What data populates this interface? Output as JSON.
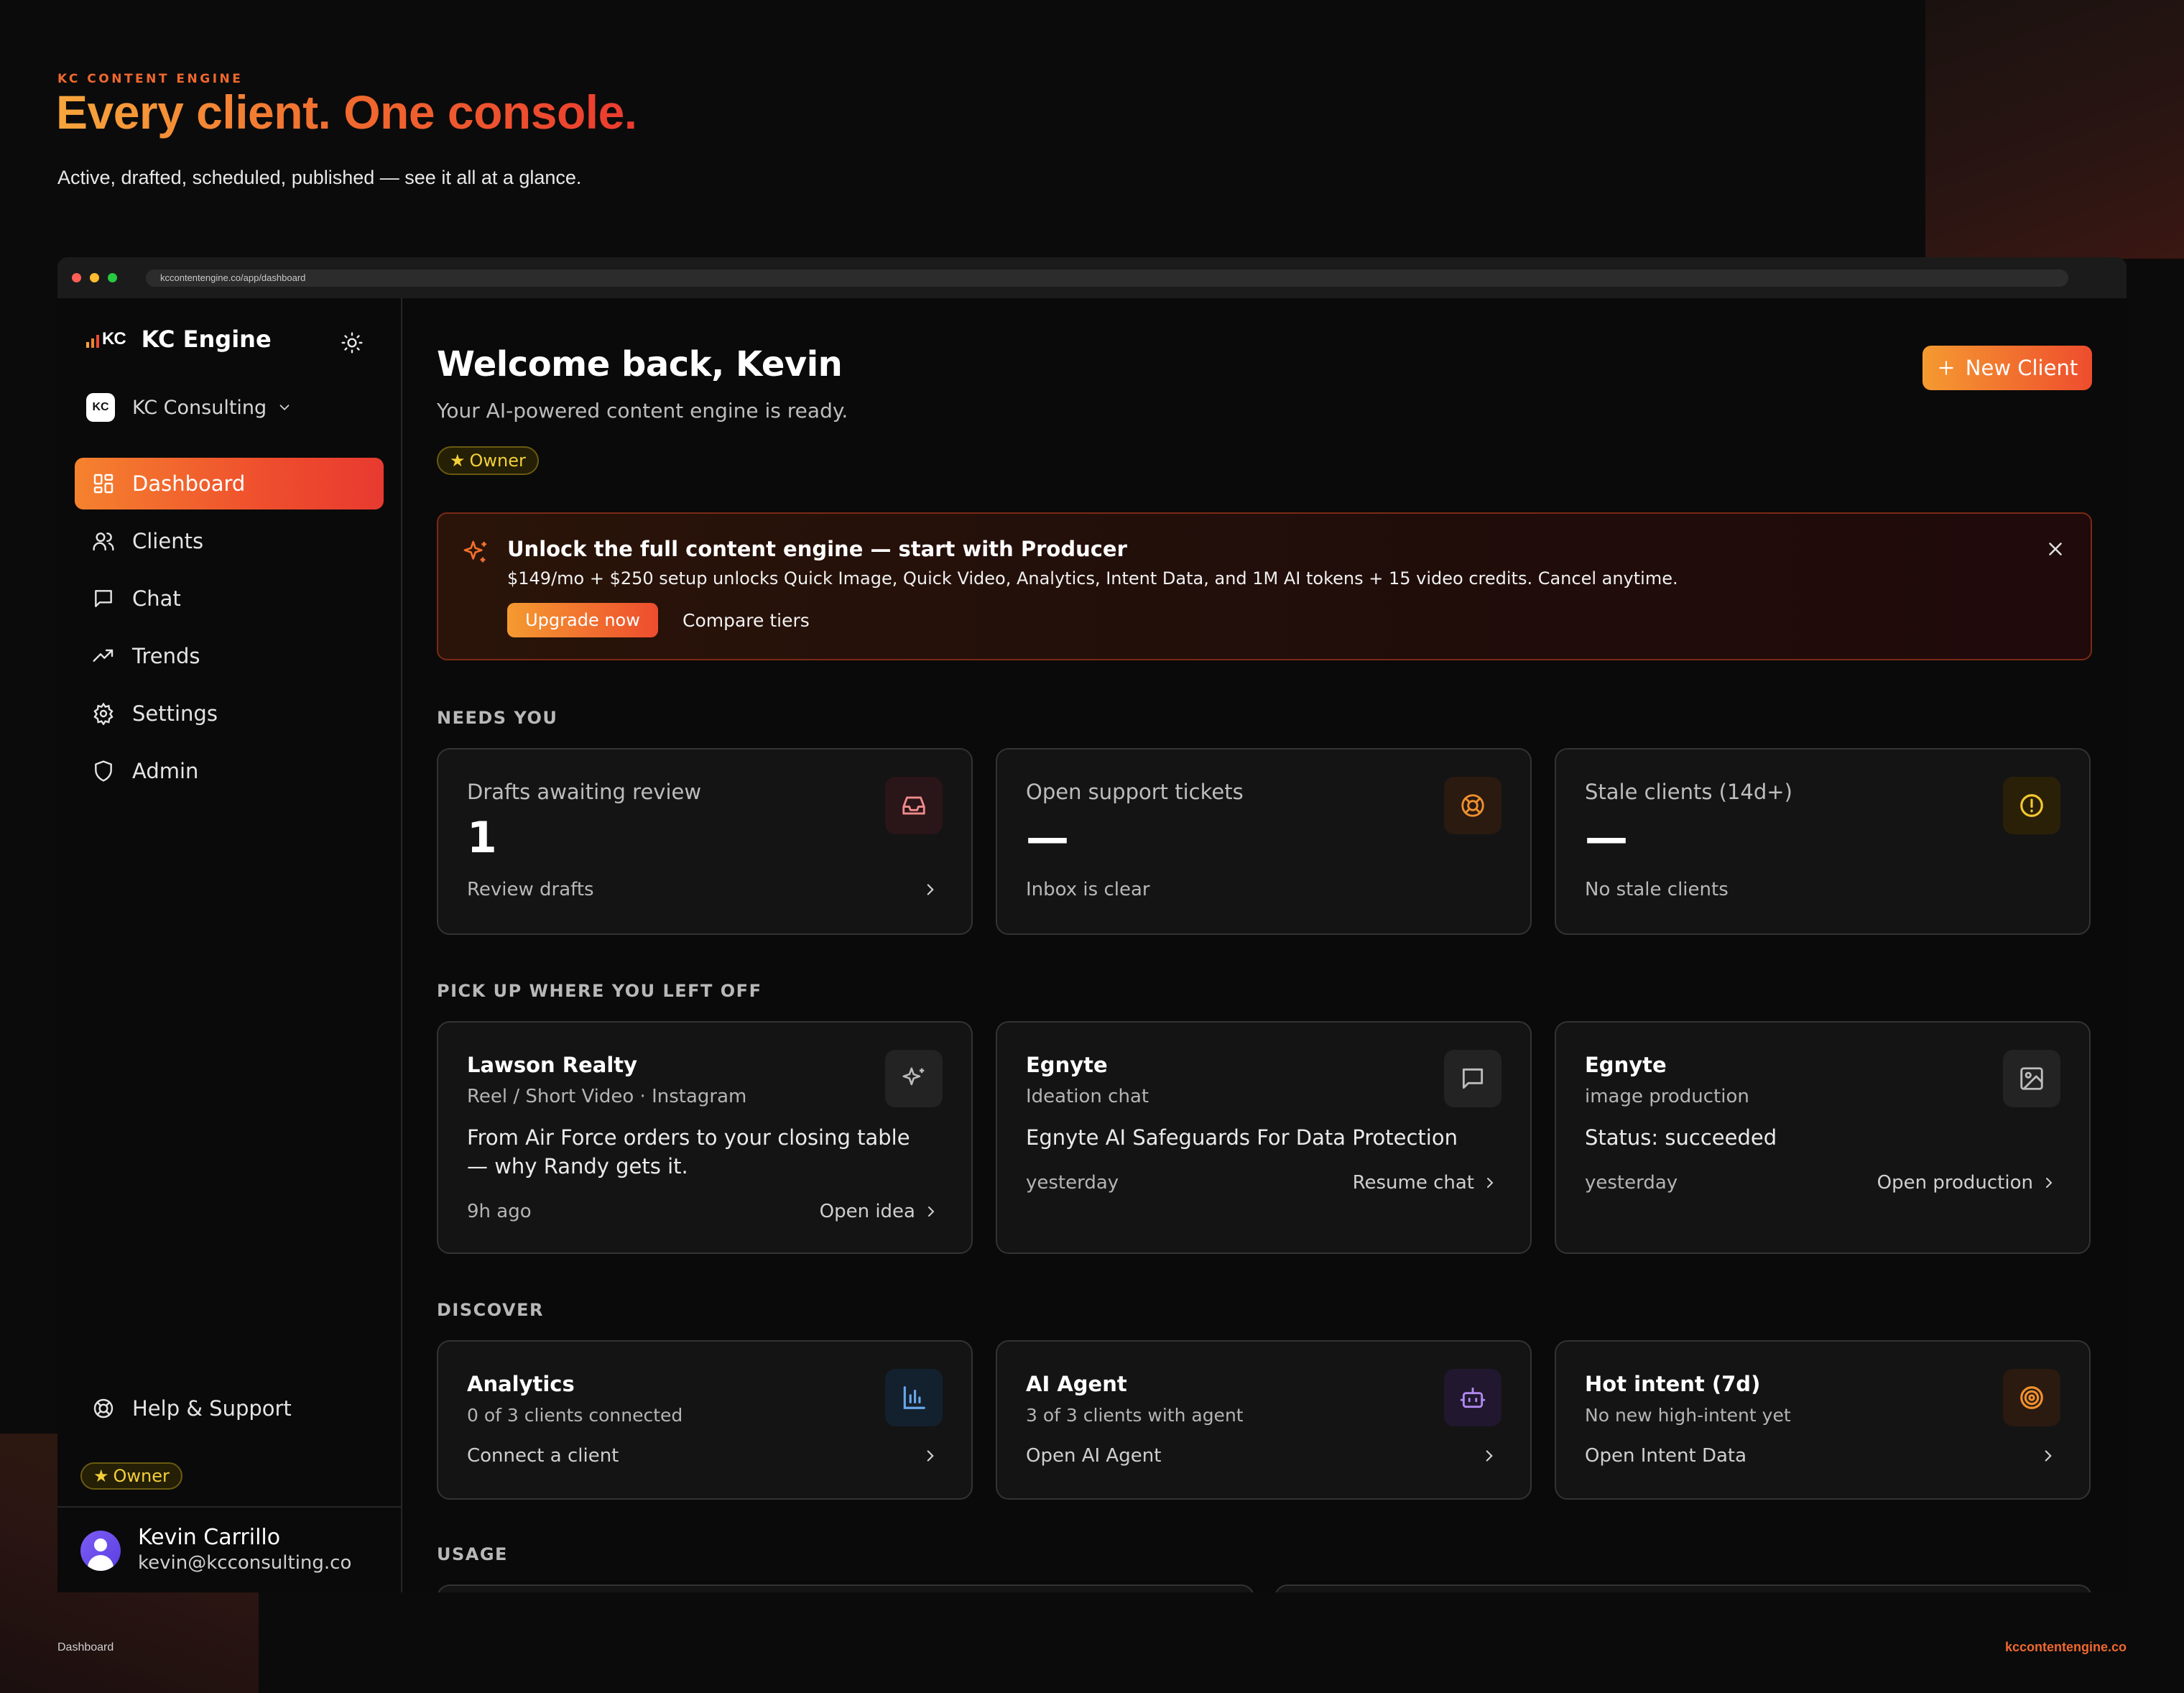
{
  "hero": {
    "kicker": "KC CONTENT ENGINE",
    "title": "Every client. One console.",
    "subtitle": "Active, drafted, scheduled, published — see it all at a glance."
  },
  "browser": {
    "url": "kccontentengine.co/app/dashboard",
    "dots": [
      "#ff5f57",
      "#febc2e",
      "#28c840"
    ]
  },
  "sidebar": {
    "brand_mark": "KC",
    "brand_name": "KC Engine",
    "org_badge": "KC",
    "org_name": "KC Consulting",
    "nav": [
      {
        "label": "Dashboard",
        "icon": "dashboard-icon",
        "active": true
      },
      {
        "label": "Clients",
        "icon": "users-icon"
      },
      {
        "label": "Chat",
        "icon": "chat-icon"
      },
      {
        "label": "Trends",
        "icon": "trend-icon"
      },
      {
        "label": "Settings",
        "icon": "gear-icon"
      },
      {
        "label": "Admin",
        "icon": "shield-icon"
      }
    ],
    "help_label": "Help & Support",
    "owner_badge": "Owner",
    "user_name": "Kevin Carrillo",
    "user_email": "kevin@kcconsulting.co"
  },
  "main": {
    "welcome": "Welcome back, Kevin",
    "subtitle": "Your AI-powered content engine is ready.",
    "owner_badge": "Owner",
    "new_client_label": "New Client",
    "promo": {
      "title": "Unlock the full content engine — start with Producer",
      "text": "$149/mo + $250 setup unlocks Quick Image, Quick Video, Analytics, Intent Data, and 1M AI tokens + 15 video credits. Cancel anytime.",
      "upgrade_label": "Upgrade now",
      "compare_label": "Compare tiers"
    },
    "needs_you": {
      "label": "NEEDS YOU",
      "cards": [
        {
          "title": "Drafts awaiting review",
          "value": "1",
          "foot": "Review drafts",
          "icon": "inbox-icon"
        },
        {
          "title": "Open support tickets",
          "value": "—",
          "foot": "Inbox is clear",
          "icon": "lifebuoy-icon"
        },
        {
          "title": "Stale clients (14d+)",
          "value": "—",
          "foot": "No stale clients",
          "icon": "alert-circle-icon"
        }
      ]
    },
    "pickup": {
      "label": "PICK UP WHERE YOU LEFT OFF",
      "cards": [
        {
          "name": "Lawson Realty",
          "meta": "Reel / Short Video · Instagram",
          "body": "From Air Force orders to your closing table — why Randy gets it.",
          "time": "9h ago",
          "link": "Open idea",
          "icon": "sparkles-icon"
        },
        {
          "name": "Egnyte",
          "meta": "Ideation chat",
          "body": "Egnyte AI Safeguards For Data Protection",
          "time": "yesterday",
          "link": "Resume chat",
          "icon": "chat-icon"
        },
        {
          "name": "Egnyte",
          "meta": "image production",
          "body": "Status: succeeded",
          "time": "yesterday",
          "link": "Open production",
          "icon": "image-icon"
        }
      ]
    },
    "discover": {
      "label": "DISCOVER",
      "cards": [
        {
          "name": "Analytics",
          "meta": "0 of 3 clients connected",
          "foot": "Connect a client",
          "icon": "bar-chart-icon"
        },
        {
          "name": "AI Agent",
          "meta": "3 of 3 clients with agent",
          "foot": "Open AI Agent",
          "icon": "bot-icon"
        },
        {
          "name": "Hot intent (7d)",
          "meta": "No new high-intent yet",
          "foot": "Open Intent Data",
          "icon": "target-icon"
        }
      ]
    },
    "usage_label": "USAGE"
  },
  "footer": {
    "left": "Dashboard",
    "right": "kccontentengine.co"
  },
  "colors": {
    "accent_orange": "#f5822e",
    "accent_red": "#e83a30",
    "owner_gold": "#f3cf3a",
    "background": "#0a0a0a"
  }
}
